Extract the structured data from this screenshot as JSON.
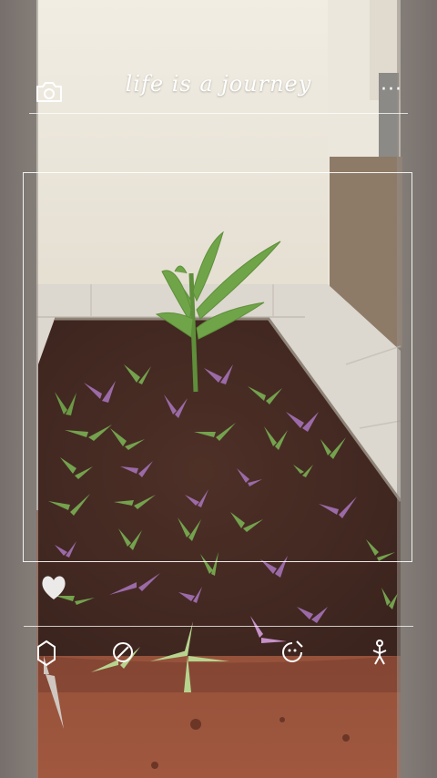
{
  "header": {
    "title": "life is a journey",
    "camera_icon": "camera-icon",
    "more_label": "···"
  },
  "toolbar": {
    "icons": [
      "filter-icon",
      "edit-icon",
      "sticker-icon",
      "pose-icon"
    ]
  },
  "overlay": {
    "heart_icon": "heart-icon"
  },
  "colors": {
    "wall": "#e9e4d9",
    "floor": "#d7d2ca",
    "soil": "#4a2d24",
    "ground": "#8a4a35",
    "leaf": "#6ea64a"
  }
}
